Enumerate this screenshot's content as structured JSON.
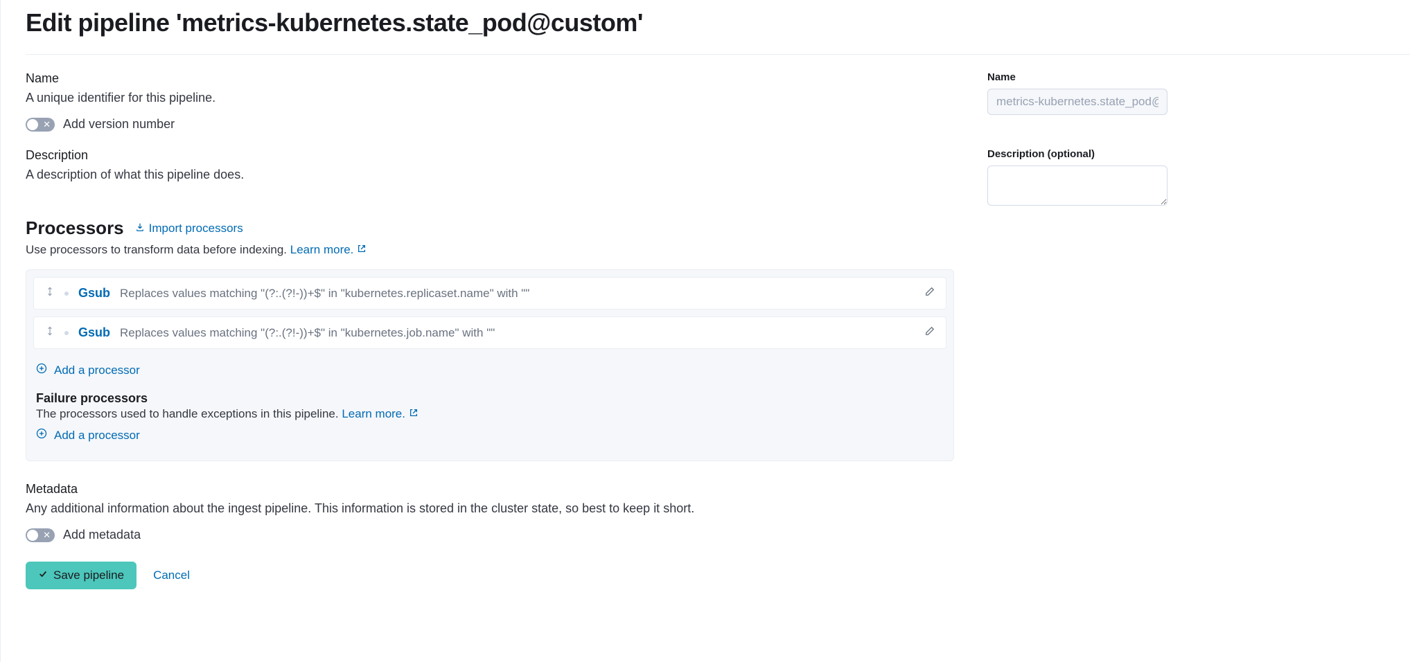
{
  "header": {
    "title": "Edit pipeline 'metrics-kubernetes.state_pod@custom'"
  },
  "name_section": {
    "label": "Name",
    "help": "A unique identifier for this pipeline.",
    "toggle_label": "Add version number"
  },
  "desc_section": {
    "label": "Description",
    "help": "A description of what this pipeline does."
  },
  "right": {
    "name_label": "Name",
    "name_value": "metrics-kubernetes.state_pod@",
    "desc_label": "Description (optional)",
    "desc_value": ""
  },
  "processors": {
    "title": "Processors",
    "import_label": "Import processors",
    "sub_text": "Use processors to transform data before indexing. ",
    "learn_more": "Learn more.",
    "rows": [
      {
        "name": "Gsub",
        "desc": "Replaces values matching \"(?:.(?!-))+$\" in \"kubernetes.replicaset.name\" with \"\""
      },
      {
        "name": "Gsub",
        "desc": "Replaces values matching \"(?:.(?!-))+$\" in \"kubernetes.job.name\" with \"\""
      }
    ],
    "add_label": "Add a processor",
    "failure_title": "Failure processors",
    "failure_sub": "The processors used to handle exceptions in this pipeline. ",
    "failure_learn_more": "Learn more."
  },
  "metadata": {
    "label": "Metadata",
    "help": "Any additional information about the ingest pipeline. This information is stored in the cluster state, so best to keep it short.",
    "toggle_label": "Add metadata"
  },
  "actions": {
    "save": "Save pipeline",
    "cancel": "Cancel"
  }
}
